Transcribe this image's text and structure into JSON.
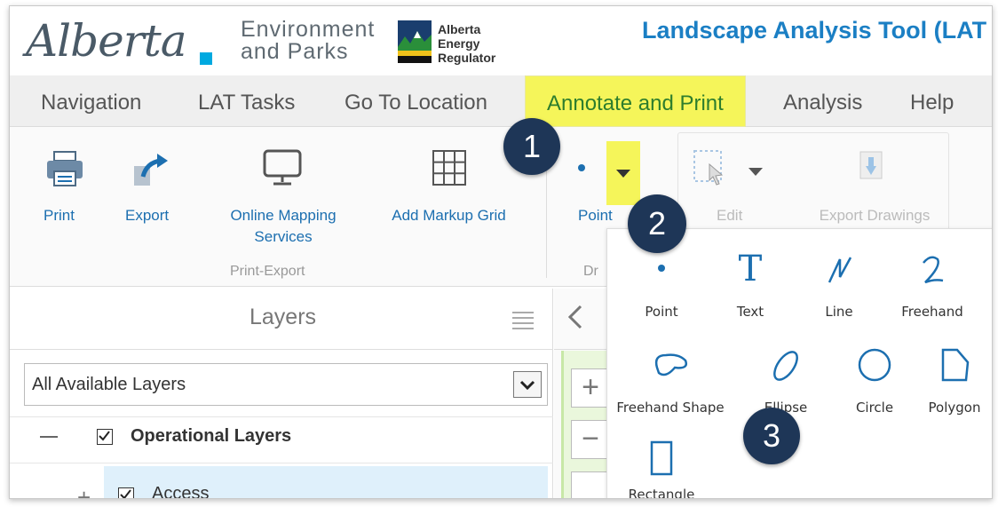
{
  "header": {
    "logo_text": "Alberta",
    "env_line1": "Environment",
    "env_line2": "and Parks",
    "aer_line1": "Alberta",
    "aer_line2": "Energy",
    "aer_line3": "Regulator",
    "app_title": "Landscape Analysis Tool (LAT"
  },
  "menu": {
    "items": [
      "Navigation",
      "LAT Tasks",
      "Go To Location",
      "Annotate and Print",
      "Analysis",
      "Help"
    ],
    "active": "Annotate and Print"
  },
  "ribbon": {
    "print": "Print",
    "export": "Export",
    "online_mapping_1": "Online Mapping",
    "online_mapping_2": "Services",
    "add_markup_grid": "Add Markup Grid",
    "print_export_group": "Print-Export",
    "point": "Point",
    "draw_group_partial": "Dr",
    "edit": "Edit",
    "export_drawings": "Export Drawings"
  },
  "layers": {
    "title": "Layers",
    "select_value": "All Available Layers",
    "operational": "Operational Layers",
    "access": "Access"
  },
  "dropdown": {
    "tools": [
      "Point",
      "Text",
      "Line",
      "Freehand",
      "Freehand Shape",
      "Ellipse",
      "Circle",
      "Polygon",
      "Rectangle"
    ]
  },
  "badges": [
    "1",
    "2",
    "3"
  ],
  "colors": {
    "accent_blue": "#1c6fb0",
    "highlight_yellow": "#f5f55a",
    "badge_navy": "#1e3657",
    "title_blue": "#1b7fc4"
  }
}
